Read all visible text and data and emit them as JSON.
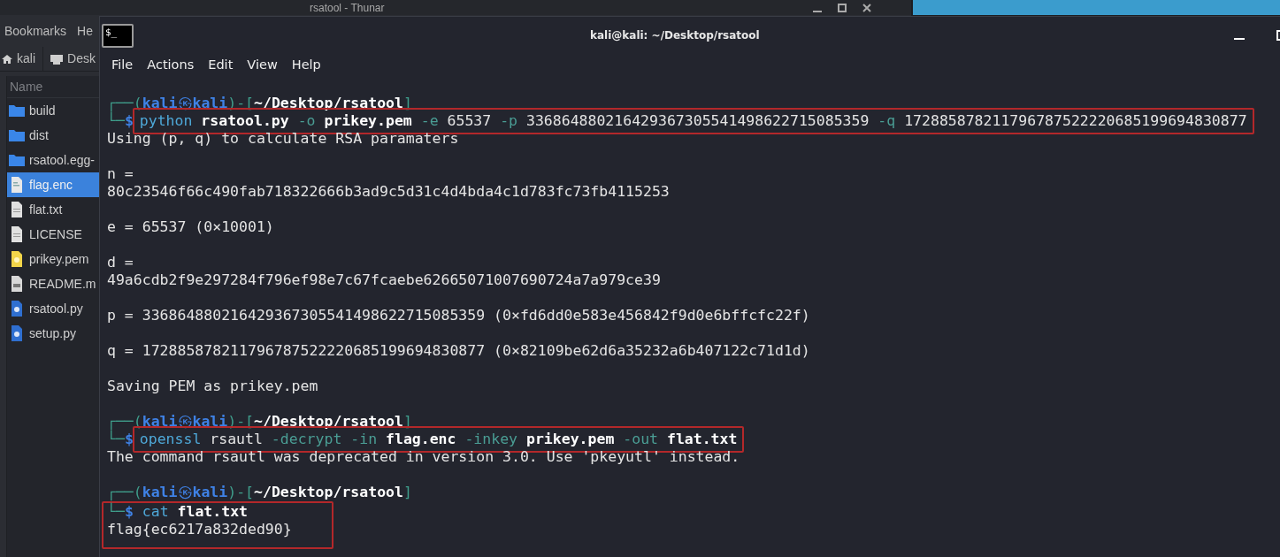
{
  "thunar": {
    "title": "rsatool - Thunar",
    "menu": [
      "Bookmarks",
      "He"
    ],
    "path": [
      {
        "label": "kali",
        "kind": "home"
      },
      {
        "label": "Desk",
        "kind": "drive"
      }
    ],
    "column": "Name",
    "files": [
      {
        "name": "build",
        "kind": "folder",
        "selected": false
      },
      {
        "name": "dist",
        "kind": "folder",
        "selected": false
      },
      {
        "name": "rsatool.egg-",
        "kind": "folder",
        "selected": false
      },
      {
        "name": "flag.enc",
        "kind": "binary",
        "selected": true
      },
      {
        "name": "flat.txt",
        "kind": "text",
        "selected": false
      },
      {
        "name": "LICENSE",
        "kind": "text",
        "selected": false
      },
      {
        "name": "prikey.pem",
        "kind": "key",
        "selected": false
      },
      {
        "name": "README.m",
        "kind": "readme",
        "selected": false
      },
      {
        "name": "rsatool.py",
        "kind": "python",
        "selected": false
      },
      {
        "name": "setup.py",
        "kind": "python",
        "selected": false
      }
    ]
  },
  "terminal": {
    "icon_text": "$_",
    "title": "kali@kali: ~/Desktop/rsatool",
    "menu": [
      "File",
      "Actions",
      "Edit",
      "View",
      "Help"
    ],
    "blocks": [
      {
        "prompt": {
          "open": "┌──(",
          "user": "kali",
          "at": "㉿",
          "host": "kali",
          "mid": ")-[",
          "path": "~/Desktop/rsatool",
          "close": "]",
          "lead": "└─",
          "symbol": "$"
        },
        "command": [
          {
            "text": "python",
            "kind": "cmd"
          },
          {
            "text": "rsatool.py",
            "kind": "file"
          },
          {
            "text": "-o",
            "kind": "opt"
          },
          {
            "text": "prikey.pem",
            "kind": "file"
          },
          {
            "text": "-e",
            "kind": "opt"
          },
          {
            "text": "65537",
            "kind": "arg"
          },
          {
            "text": "-p",
            "kind": "opt"
          },
          {
            "text": "336864880216429367305541498622715085359",
            "kind": "arg"
          },
          {
            "text": "-q",
            "kind": "opt"
          },
          {
            "text": "172885878211796787522220685199694830877",
            "kind": "arg"
          }
        ],
        "boxed": true,
        "box_includes_output": false,
        "output": [
          [
            "Using (p, q) to calculate RSA paramaters"
          ],
          [
            "n =",
            "80c23546f66c490fab718322666b3ad9c5d31c4d4bda4c1d783fc73fb4115253"
          ],
          [
            "e = 65537 (0×10001)"
          ],
          [
            "d =",
            "49a6cdb2f9e297284f796ef98e7c67fcaebe62665071007690724a7a979ce39"
          ],
          [
            "p = 336864880216429367305541498622715085359 (0×fd6dd0e583e456842f9d0e6bffcfc22f)"
          ],
          [
            "q = 172885878211796787522220685199694830877 (0×82109be62d6a35232a6b407122c71d1d)"
          ],
          [
            "Saving PEM as prikey.pem"
          ]
        ]
      },
      {
        "prompt": {
          "open": "┌──(",
          "user": "kali",
          "at": "㉿",
          "host": "kali",
          "mid": ")-[",
          "path": "~/Desktop/rsatool",
          "close": "]",
          "lead": "└─",
          "symbol": "$"
        },
        "command": [
          {
            "text": "openssl",
            "kind": "cmd"
          },
          {
            "text": "rsautl",
            "kind": "arg"
          },
          {
            "text": "-decrypt",
            "kind": "opt"
          },
          {
            "text": "-in",
            "kind": "opt"
          },
          {
            "text": "flag.enc",
            "kind": "file"
          },
          {
            "text": "-inkey",
            "kind": "opt"
          },
          {
            "text": "prikey.pem",
            "kind": "file"
          },
          {
            "text": "-out",
            "kind": "opt"
          },
          {
            "text": "flat.txt",
            "kind": "file"
          }
        ],
        "boxed": true,
        "box_includes_output": false,
        "output": [
          [
            "The command rsautl was deprecated in version 3.0. Use 'pkeyutl' instead."
          ]
        ]
      },
      {
        "prompt": {
          "open": "┌──(",
          "user": "kali",
          "at": "㉿",
          "host": "kali",
          "mid": ")-[",
          "path": "~/Desktop/rsatool",
          "close": "]",
          "lead": "└─",
          "symbol": "$"
        },
        "command": [
          {
            "text": "cat",
            "kind": "cmd"
          },
          {
            "text": "flat.txt",
            "kind": "file"
          }
        ],
        "boxed": true,
        "box_includes_output": true,
        "output": [
          [
            "flag{ec6217a832ded90}"
          ]
        ]
      }
    ]
  }
}
